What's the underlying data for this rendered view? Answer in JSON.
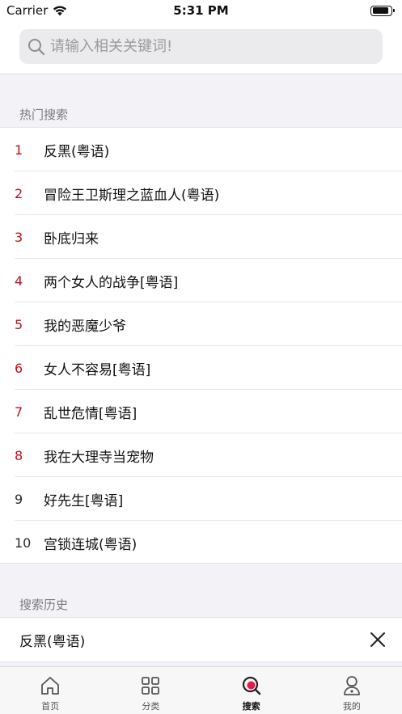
{
  "status_bar": {
    "carrier": "Carrier",
    "time": "5:31 PM"
  },
  "search": {
    "placeholder": "请输入相关关键词!"
  },
  "hot": {
    "title": "热门搜索",
    "items": [
      {
        "rank": "1",
        "text": "反黑(粤语)"
      },
      {
        "rank": "2",
        "text": "冒险王卫斯理之蓝血人(粤语)"
      },
      {
        "rank": "3",
        "text": "卧底归来"
      },
      {
        "rank": "4",
        "text": "两个女人的战争[粤语]"
      },
      {
        "rank": "5",
        "text": "我的恶魔少爷"
      },
      {
        "rank": "6",
        "text": "女人不容易[粤语]"
      },
      {
        "rank": "7",
        "text": "乱世危情[粤语]"
      },
      {
        "rank": "8",
        "text": "我在大理寺当宠物"
      },
      {
        "rank": "9",
        "text": "好先生[粤语]"
      },
      {
        "rank": "10",
        "text": "宫锁连城(粤语)"
      }
    ]
  },
  "history": {
    "title": "搜索历史",
    "items": [
      {
        "text": "反黑(粤语)"
      }
    ]
  },
  "tabs": [
    {
      "label": "首页",
      "icon": "home-icon"
    },
    {
      "label": "分类",
      "icon": "grid-icon"
    },
    {
      "label": "搜索",
      "icon": "search-tab-icon"
    },
    {
      "label": "我的",
      "icon": "profile-icon"
    }
  ],
  "colors": {
    "accent": "#c0101c",
    "search_dot": "#e8194a"
  }
}
